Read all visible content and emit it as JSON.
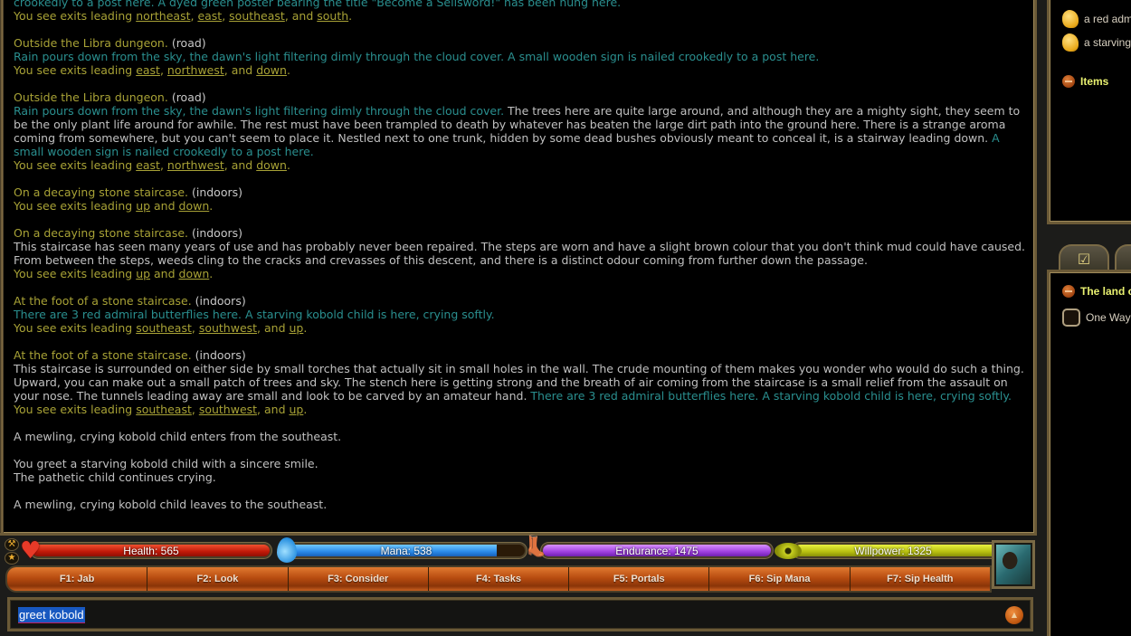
{
  "output": {
    "top_partial": {
      "text": "crookedly to a post here. A dyed green poster bearing the title \"Become a Sellsword!\" has been hung here.",
      "exits_prefix": "You see exits leading ",
      "exits": [
        "northeast",
        "east",
        "southeast",
        "south"
      ]
    },
    "blocks": [
      {
        "room": "Outside the Libra dungeon.",
        "env": "(road)",
        "mob_text": "Rain pours down from the sky, the dawn's light filtering dimly through the cloud cover. A small wooden sign is nailed crookedly to a post here.",
        "exits_prefix": "You see exits leading ",
        "exits": [
          "east",
          "northwest",
          "down"
        ]
      },
      {
        "room": "Outside the Libra dungeon.",
        "env": "(road)",
        "mob_text": "Rain pours down from the sky, the dawn's light filtering dimly through the cloud cover.",
        "desc": " The trees here are quite large around, and although they are a mighty sight, they seem to be the only plant life around for awhile. The rest must have been trampled to death by whatever has beaten the large dirt path into the ground here. There is a strange aroma coming from somewhere, but you can't seem to place it. Nestled next to one trunk, hidden by some dead bushes obviously meant to conceal it, is a stairway leading down.",
        "mob_text2": " A small wooden sign is nailed crookedly to a post here.",
        "exits_prefix": "You see exits leading ",
        "exits": [
          "east",
          "northwest",
          "down"
        ]
      },
      {
        "room": "On a decaying stone staircase.",
        "env": "(indoors)",
        "exits_prefix": "You see exits leading ",
        "exits": [
          "up",
          "down"
        ]
      },
      {
        "room": "On a decaying stone staircase.",
        "env": "(indoors)",
        "desc": "This staircase has seen many years of use and has probably never been repaired. The steps are worn and have a slight brown colour that you don't think mud could have caused. From between the steps, weeds cling to the cracks and crevasses of this descent, and there is a distinct odour coming from further down the passage.",
        "exits_prefix": "You see exits leading ",
        "exits": [
          "up",
          "down"
        ]
      },
      {
        "room": "At the foot of a stone staircase.",
        "env": "(indoors)",
        "mob_text": "There are 3 red admiral butterflies here. A starving kobold child is here, crying softly.",
        "exits_prefix": "You see exits leading ",
        "exits": [
          "southeast",
          "southwest",
          "up"
        ]
      },
      {
        "room": "At the foot of a stone staircase.",
        "env": "(indoors)",
        "desc": "This staircase is surrounded on either side by small torches that actually sit in small holes in the wall. The crude mounting of them makes you wonder who would do such a thing. Upward, you can make out a small patch of trees and sky. The stench here is getting strong and the breath of air coming from the staircase is a small relief from the assault on your nose. The tunnels leading away are small and look to be carved by an amateur hand.",
        "mob_text2": " There are 3 red admiral butterflies here. A starving kobold child is here, crying softly.",
        "exits_prefix": "You see exits leading ",
        "exits": [
          "southeast",
          "southwest",
          "up"
        ]
      }
    ],
    "messages": [
      [
        "A mewling, crying kobold child enters from the southeast."
      ],
      [
        "You greet a starving kobold child with a sincere smile.",
        "The pathetic child continues crying."
      ],
      [
        "A mewling, crying kobold child leaves to the southeast."
      ]
    ]
  },
  "room_panel": {
    "entities": [
      "a red admiral butterfly",
      "a starving kobold child"
    ],
    "items_label": "Items"
  },
  "quest_panel": {
    "title": "The land of Libra",
    "items": [
      {
        "label": "One Way",
        "checked": false
      }
    ]
  },
  "vitals": {
    "health": {
      "label": "Health: 565",
      "fraction": 1.0
    },
    "mana": {
      "label": "Mana: 538",
      "fraction": 0.88
    },
    "endurance": {
      "label": "Endurance: 1475",
      "fraction": 1.0
    },
    "willpower": {
      "label": "Willpower: 1325",
      "fraction": 1.0
    }
  },
  "fkeys": [
    "F1: Jab",
    "F2: Look",
    "F3: Consider",
    "F4: Tasks",
    "F5: Portals",
    "F6: Sip Mana",
    "F7: Sip Health"
  ],
  "input": {
    "value": "greet kobold"
  },
  "colors": {
    "room_title": "#a8a236",
    "mob_text": "#2a8f8f",
    "plain_text": "#c0c0c0",
    "fkey_orange": "#b84c10",
    "frame_gold": "#6b5a37"
  }
}
